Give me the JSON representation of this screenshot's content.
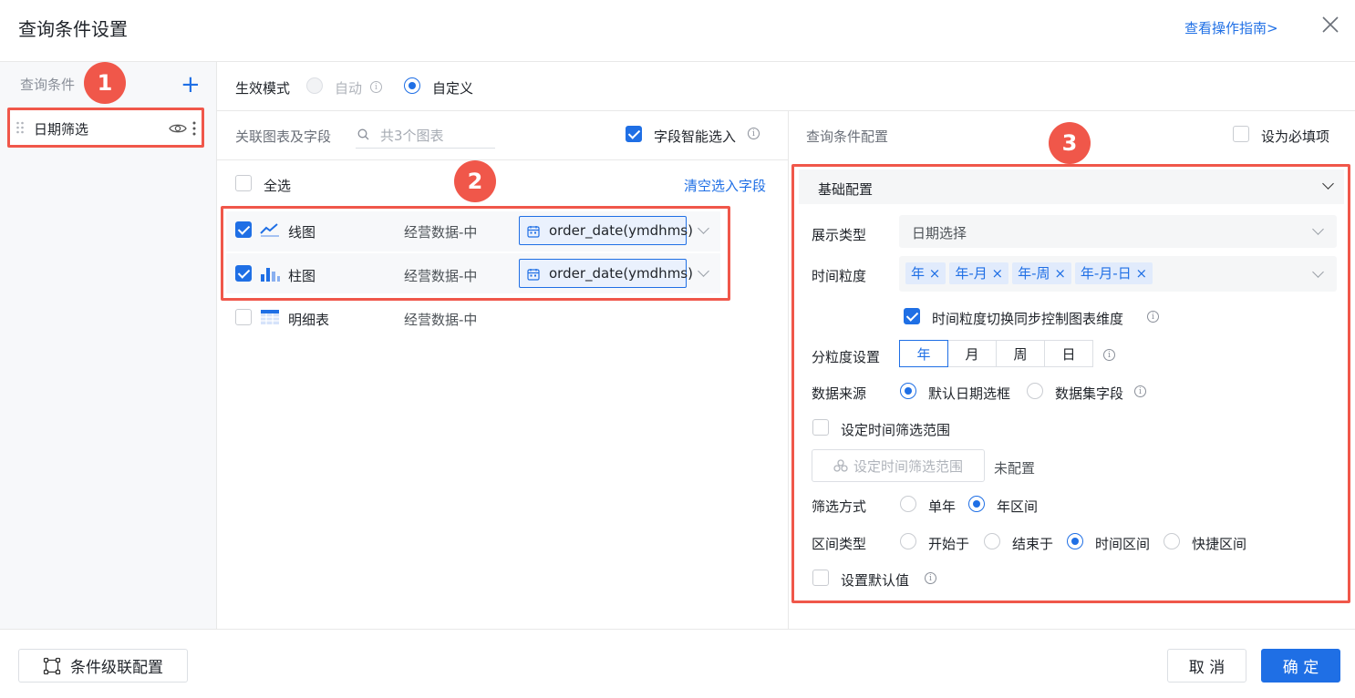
{
  "dialog": {
    "title": "查询条件设置",
    "guide_link": "查看操作指南>"
  },
  "left_panel": {
    "label": "查询条件",
    "item": "日期筛选"
  },
  "badges": [
    "1",
    "2",
    "3"
  ],
  "mode": {
    "label": "生效模式",
    "options": [
      "自动",
      "自定义"
    ],
    "selected": "自定义"
  },
  "middle": {
    "label": "关联图表及字段",
    "search_placeholder": "共3个图表",
    "smart_select": "字段智能选入",
    "select_all": "全选",
    "clear": "清空选入字段",
    "rows": [
      {
        "name": "线图",
        "dataset": "经营数据-中",
        "field": "order_date(ymdhms)",
        "checked": true
      },
      {
        "name": "柱图",
        "dataset": "经营数据-中",
        "field": "order_date(ymdhms)",
        "checked": true
      },
      {
        "name": "明细表",
        "dataset": "经营数据-中",
        "checked": false
      }
    ]
  },
  "right": {
    "label": "查询条件配置",
    "required": "设为必填项",
    "section": "基础配置",
    "display_type_label": "展示类型",
    "display_type_value": "日期选择",
    "granularity_label": "时间粒度",
    "granularity_tags": [
      "年",
      "年-月",
      "年-周",
      "年-月-日"
    ],
    "sync_label": "时间粒度切换同步控制图表维度",
    "sub_gran_label": "分粒度设置",
    "sub_gran": [
      "年",
      "月",
      "周",
      "日"
    ],
    "source_label": "数据来源",
    "source_options": [
      "默认日期选框",
      "数据集字段"
    ],
    "range_check": "设定时间筛选范围",
    "range_button": "设定时间筛选范围",
    "range_status": "未配置",
    "filter_label": "筛选方式",
    "filter_options": [
      "单年",
      "年区间"
    ],
    "interval_label": "区间类型",
    "interval_options": [
      "开始于",
      "结束于",
      "时间区间",
      "快捷区间"
    ],
    "default_label": "设置默认值"
  },
  "footer": {
    "cascade": "条件级联配置",
    "cancel": "取 消",
    "confirm": "确 定"
  },
  "colors": {
    "accent": "#1f6fe5",
    "highlight": "#f0574a"
  }
}
